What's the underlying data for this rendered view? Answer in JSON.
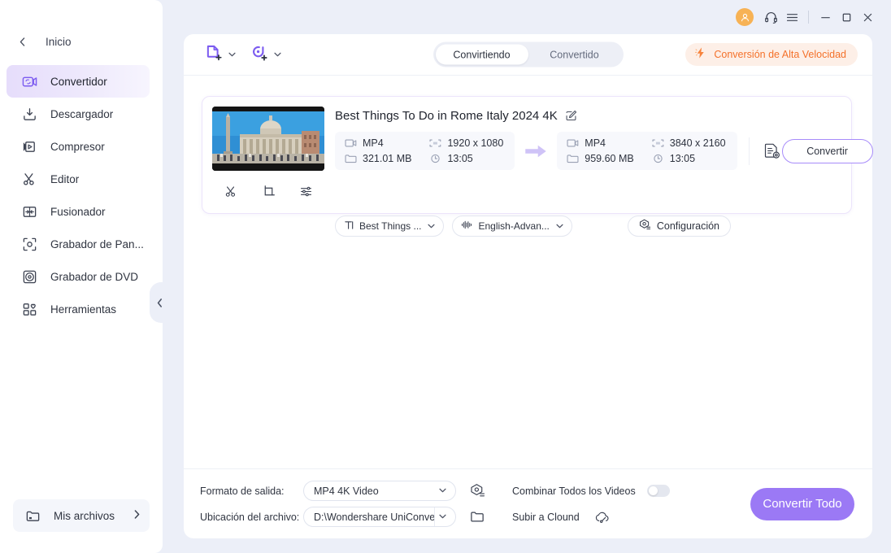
{
  "window": {
    "avatar_icon": "user-avatar-icon",
    "support_icon": "headset-icon",
    "menu_icon": "hamburger-menu-icon",
    "minimize_icon": "minimize-icon",
    "maximize_icon": "maximize-icon",
    "close_icon": "close-icon"
  },
  "sidebar": {
    "back_caret": "‹",
    "home_label": "Inicio",
    "items": [
      {
        "label": "Convertidor",
        "icon": "converter-icon",
        "active": true
      },
      {
        "label": "Descargador",
        "icon": "downloader-icon",
        "active": false
      },
      {
        "label": "Compresor",
        "icon": "compressor-icon",
        "active": false
      },
      {
        "label": "Editor",
        "icon": "scissors-icon",
        "active": false
      },
      {
        "label": "Fusionador",
        "icon": "merger-icon",
        "active": false
      },
      {
        "label": "Grabador de Pan...",
        "icon": "screen-recorder-icon",
        "active": false
      },
      {
        "label": "Grabador de DVD",
        "icon": "dvd-burner-icon",
        "active": false
      },
      {
        "label": "Herramientas",
        "icon": "toolbox-icon",
        "active": false
      }
    ],
    "my_files": {
      "label": "Mis archivos",
      "icon": "folder-icon",
      "caret": "›"
    },
    "collapse_caret": "◄"
  },
  "toolbar": {
    "add_file_icon": "add-file-icon",
    "add_file_caret": "▾",
    "add_media_icon": "add-media-icon",
    "add_media_caret": "▾",
    "tabs": [
      {
        "label": "Convirtiendo",
        "active": true
      },
      {
        "label": "Convertido",
        "active": false
      }
    ],
    "highspeed": {
      "label": "Conversión de Alta Velocidad",
      "icon": "lightning-bolt-icon",
      "color": "#f4712a",
      "background": "#fdefe7"
    }
  },
  "file_card": {
    "thumbnail_alt": "st-peters-basilica-thumbnail",
    "title": "Best Things To Do in Rome Italy 2024 4K",
    "edit_icon": "edit-pencil-icon",
    "tools": [
      {
        "icon": "scissors-trim-icon",
        "name": "trim-tool"
      },
      {
        "icon": "crop-icon",
        "name": "crop-tool"
      },
      {
        "icon": "effects-sliders-icon",
        "name": "effects-tool"
      }
    ],
    "source": {
      "format": "MP4",
      "resolution": "1920 x 1080",
      "size": "321.01 MB",
      "duration": "13:05",
      "format_icon": "video-camera-icon",
      "resolution_icon": "resolution-icon",
      "size_icon": "folder-size-icon",
      "duration_icon": "clock-icon"
    },
    "arrow_icon": "right-arrow-icon",
    "target": {
      "format": "MP4",
      "resolution": "3840 x 2160",
      "size": "959.60 MB",
      "duration": "13:05",
      "format_icon": "video-camera-icon",
      "resolution_icon": "resolution-icon",
      "size_icon": "folder-size-icon",
      "duration_icon": "clock-icon"
    },
    "preset_icon": "document-settings-icon",
    "convert_button": "Convertir",
    "subtitle_pill": {
      "label": "Best Things ...",
      "icon": "subtitle-text-icon",
      "caret": "▾"
    },
    "audio_pill": {
      "label": "English-Advan...",
      "icon": "audio-waveform-icon",
      "caret": "▾"
    },
    "settings_button": {
      "label": "Configuración",
      "icon": "settings-gear-icon"
    }
  },
  "bottom_bar": {
    "output_format_label": "Formato de salida:",
    "output_format_value": "MP4 4K Video",
    "output_format_caret": "▾",
    "output_format_icon": "format-settings-icon",
    "file_location_label": "Ubicación del archivo:",
    "file_location_value": "D:\\Wondershare UniConverter",
    "file_location_caret": "▾",
    "file_location_icon": "open-folder-icon",
    "merge_label": "Combinar Todos los Videos",
    "merge_toggle_on": false,
    "cloud_label": "Subir a Clound",
    "cloud_icon": "cloud-upload-icon",
    "convert_all_button": "Convertir Todo",
    "accent_color": "#9b79f5"
  }
}
